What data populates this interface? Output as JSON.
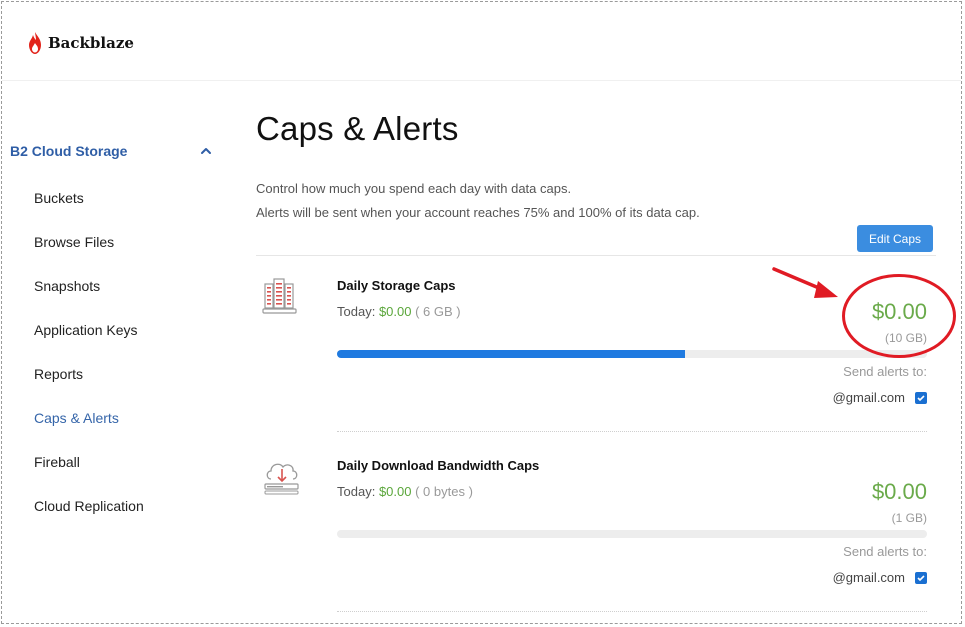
{
  "brand": {
    "name": "Backblaze",
    "color": "#e2231a"
  },
  "sidebar": {
    "section_title": "B2 Cloud Storage",
    "items": [
      {
        "label": "Buckets",
        "active": false
      },
      {
        "label": "Browse Files",
        "active": false
      },
      {
        "label": "Snapshots",
        "active": false
      },
      {
        "label": "Application Keys",
        "active": false
      },
      {
        "label": "Reports",
        "active": false
      },
      {
        "label": "Caps & Alerts",
        "active": true
      },
      {
        "label": "Fireball",
        "active": false
      },
      {
        "label": "Cloud Replication",
        "active": false
      }
    ]
  },
  "main": {
    "title": "Caps & Alerts",
    "description_line1": "Control how much you spend each day with data caps.",
    "description_line2": "Alerts will be sent when your account reaches 75% and 100% of its data cap.",
    "edit_button_label": "Edit Caps",
    "caps": [
      {
        "title": "Daily Storage Caps",
        "today_label": "Today:",
        "today_amount": "$0.00",
        "today_usage": "( 6 GB )",
        "cap_amount": "$0.00",
        "cap_limit": "(10 GB)",
        "progress_fraction": 0.59,
        "send_alerts_label": "Send alerts to:",
        "email": "@gmail.com",
        "email_checked": true,
        "icon": "server-building-icon"
      },
      {
        "title": "Daily Download Bandwidth Caps",
        "today_label": "Today:",
        "today_amount": "$0.00",
        "today_usage": "( 0 bytes )",
        "cap_amount": "$0.00",
        "cap_limit": "(1 GB)",
        "progress_fraction": 0,
        "send_alerts_label": "Send alerts to:",
        "email": "@gmail.com",
        "email_checked": true,
        "icon": "cloud-download-icon"
      }
    ]
  },
  "colors": {
    "accent_blue": "#3b8de0",
    "progress_blue": "#1f7ae0",
    "amount_green": "#6aaa4a",
    "annotation_red": "#e01b24"
  }
}
